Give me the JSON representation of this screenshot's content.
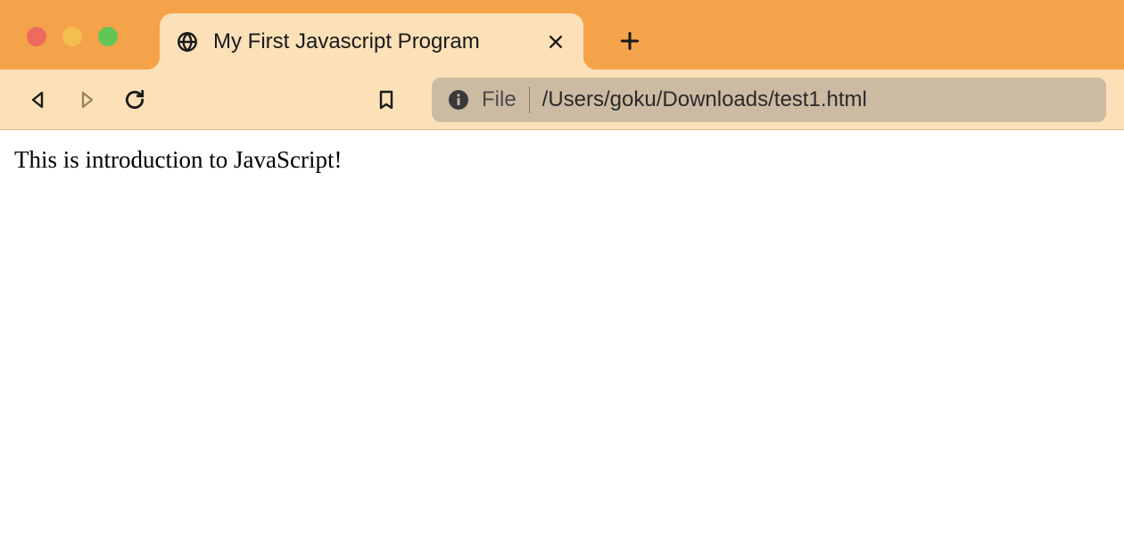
{
  "tab": {
    "title": "My First Javascript Program"
  },
  "address_bar": {
    "scheme_label": "File",
    "path": "/Users/goku/Downloads/test1.html"
  },
  "page": {
    "body_text": "This is introduction to JavaScript!"
  }
}
